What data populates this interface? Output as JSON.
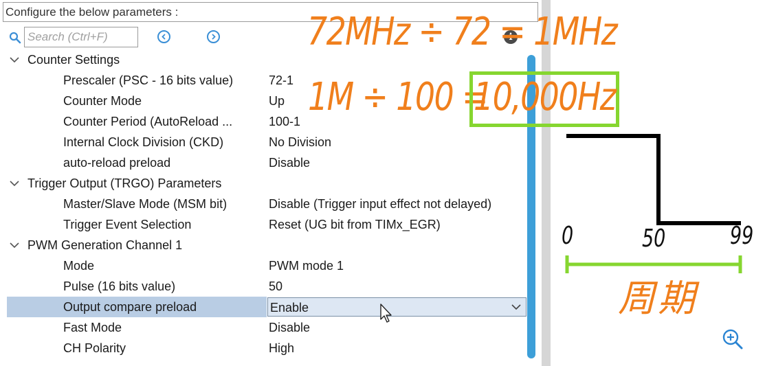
{
  "panel": {
    "header": "Configure the below parameters :",
    "search": {
      "placeholder": "Search (Ctrl+F)",
      "value": ""
    }
  },
  "tree": {
    "groups": [
      {
        "label": "Counter Settings",
        "params": [
          {
            "label": "Prescaler (PSC - 16 bits value)",
            "value": "72-1"
          },
          {
            "label": "Counter Mode",
            "value": "Up"
          },
          {
            "label": "Counter Period (AutoReload ...",
            "value": "100-1"
          },
          {
            "label": "Internal Clock Division (CKD)",
            "value": "No Division"
          },
          {
            "label": "auto-reload preload",
            "value": "Disable"
          }
        ]
      },
      {
        "label": "Trigger Output (TRGO) Parameters",
        "params": [
          {
            "label": "Master/Slave Mode (MSM bit)",
            "value": "Disable (Trigger input effect not delayed)"
          },
          {
            "label": "Trigger Event Selection",
            "value": "Reset (UG bit from TIMx_EGR)"
          }
        ]
      },
      {
        "label": "PWM Generation Channel 1",
        "params": [
          {
            "label": "Mode",
            "value": "PWM mode 1"
          },
          {
            "label": "Pulse (16 bits value)",
            "value": "50"
          },
          {
            "label": "Output compare preload",
            "value": "Enable",
            "selected": true
          },
          {
            "label": "Fast Mode",
            "value": "Disable"
          },
          {
            "label": "CH Polarity",
            "value": "High"
          }
        ]
      }
    ]
  },
  "annotations": {
    "formula_1": "72MHz ÷ 72 = 1MHz",
    "formula_2_prefix": "1M ÷ 100 = ",
    "formula_2_result": "10,000Hz",
    "ticks": {
      "start": "0",
      "mid": "50",
      "end": "99"
    },
    "period": "周期",
    "colors": {
      "annotation": "#f07f1c",
      "highlight": "#86d630",
      "waveform": "#000000"
    }
  },
  "icons": {
    "search": "search-icon",
    "prev": "chevron-left-circle-icon",
    "next": "chevron-right-circle-icon",
    "info": "info-icon",
    "group_toggle": "chevron-down-icon",
    "dropdown": "chevron-down-icon",
    "cursor": "mouse-cursor-icon",
    "zoom": "zoom-in-icon"
  },
  "colors": {
    "accent": "#3d9fd8",
    "selection": "#b9cde4",
    "divider": "#d6d6d6"
  }
}
